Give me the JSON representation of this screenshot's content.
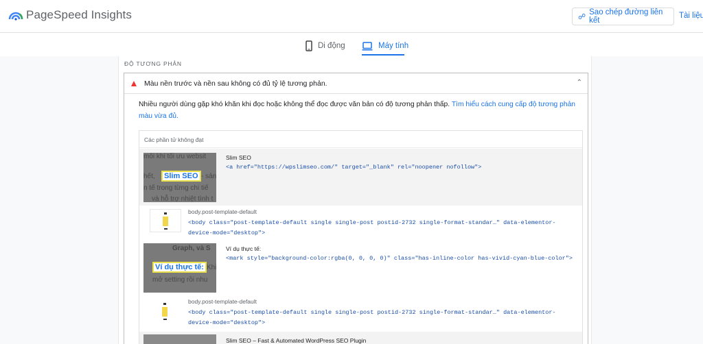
{
  "header": {
    "app_title": "PageSpeed Insights",
    "copy_link_label": "Sao chép đường liên kết",
    "docs_label": "Tài liệu"
  },
  "tabs": [
    {
      "label": "Di động",
      "icon": "phone-icon",
      "active": false
    },
    {
      "label": "Máy tính",
      "icon": "laptop-icon",
      "active": true
    }
  ],
  "section": {
    "label": "ĐỘ TƯƠNG PHẢN"
  },
  "audit": {
    "title": "Màu nền trước và nền sau không có đủ tỷ lệ tương phản.",
    "status_icon": "warning-triangle-icon",
    "status_color": "#e33333",
    "description": "Nhiều người dùng gặp khó khăn khi đọc hoặc không thể đọc được văn bản có độ tương phản thấp.",
    "link_text": "Tìm hiểu cách cung cấp độ tương phản màu vừa đủ."
  },
  "table": {
    "header": "Các phần tử không đạt",
    "rows": [
      {
        "label": "Slim SEO",
        "code": "<a href=\"https://wpslimseo.com/\" target=\"_blank\" rel=\"noopener nofollow\">",
        "thumb_lines": [
          "mỗi khi tối ưu websit",
          "hết,",
          "- sản",
          "n tế trong từng chi tiế",
          "và hỗ trợ nhiệt tình t"
        ],
        "thumb_highlight": "Slim SEO"
      },
      {
        "label": "body.post-template-default",
        "code_line1": "<body class=\"post-template-default single single-post postid-2732 single-format-standar…\" data-elementor-",
        "code_line2": "device-mode=\"desktop\">"
      },
      {
        "label": "Ví dụ thực tế:",
        "code": "<mark style=\"background-color:rgba(0, 0, 0, 0)\" class=\"has-inline-color has-vivid-cyan-blue-color\">",
        "thumb_lines": [
          "Graph, và S",
          "Khi",
          "mở setting rồi nhu"
        ],
        "thumb_highlight": "Ví dụ thực tế:"
      },
      {
        "label": "body.post-template-default",
        "code_line1": "<body class=\"post-template-default single single-post postid-2732 single-format-standar…\" data-elementor-",
        "code_line2": "device-mode=\"desktop\">"
      },
      {
        "label": "Slim SEO – Fast & Automated WordPress SEO Plugin"
      }
    ]
  }
}
